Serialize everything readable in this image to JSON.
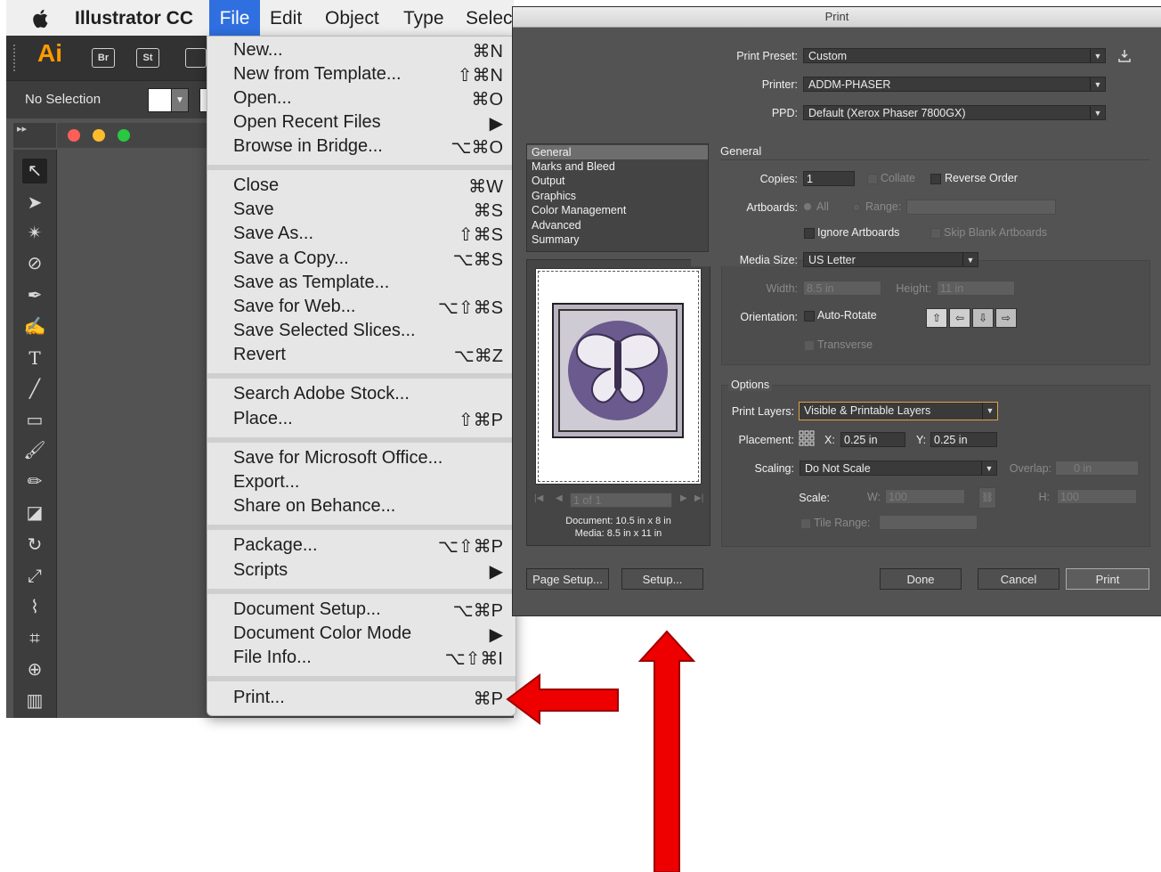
{
  "menubar": {
    "app_name": "Illustrator CC",
    "items": [
      "File",
      "Edit",
      "Object",
      "Type",
      "Selec"
    ]
  },
  "app": {
    "logo": "Ai",
    "pills": [
      "Br",
      "St"
    ],
    "control_text": "No Selection"
  },
  "file_menu": {
    "items": [
      {
        "label": "New...",
        "shortcut": "⌘N"
      },
      {
        "label": "New from Template...",
        "shortcut": "⇧⌘N"
      },
      {
        "label": "Open...",
        "shortcut": "⌘O"
      },
      {
        "label": "Open Recent Files",
        "shortcut": "▶"
      },
      {
        "label": "Browse in Bridge...",
        "shortcut": "⌥⌘O"
      },
      {
        "label": "Close",
        "shortcut": "⌘W"
      },
      {
        "label": "Save",
        "shortcut": "⌘S"
      },
      {
        "label": "Save As...",
        "shortcut": "⇧⌘S"
      },
      {
        "label": "Save a Copy...",
        "shortcut": "⌥⌘S"
      },
      {
        "label": "Save as Template...",
        "shortcut": ""
      },
      {
        "label": "Save for Web...",
        "shortcut": "⌥⇧⌘S"
      },
      {
        "label": "Save Selected Slices...",
        "shortcut": ""
      },
      {
        "label": "Revert",
        "shortcut": "⌥⌘Z"
      },
      {
        "label": "Search Adobe Stock...",
        "shortcut": ""
      },
      {
        "label": "Place...",
        "shortcut": "⇧⌘P"
      },
      {
        "label": "Save for Microsoft Office...",
        "shortcut": ""
      },
      {
        "label": "Export...",
        "shortcut": ""
      },
      {
        "label": "Share on Behance...",
        "shortcut": ""
      },
      {
        "label": "Package...",
        "shortcut": "⌥⇧⌘P"
      },
      {
        "label": "Scripts",
        "shortcut": "▶"
      },
      {
        "label": "Document Setup...",
        "shortcut": "⌥⌘P"
      },
      {
        "label": "Document Color Mode",
        "shortcut": "▶"
      },
      {
        "label": "File Info...",
        "shortcut": "⌥⇧⌘I"
      },
      {
        "label": "Print...",
        "shortcut": "⌘P"
      }
    ]
  },
  "print_dialog": {
    "title": "Print",
    "preset_label": "Print Preset:",
    "preset_value": "Custom",
    "printer_label": "Printer:",
    "printer_value": "ADDM-PHASER",
    "ppd_label": "PPD:",
    "ppd_value": "Default (Xerox Phaser 7800GX)",
    "categories": [
      "General",
      "Marks and Bleed",
      "Output",
      "Graphics",
      "Color Management",
      "Advanced",
      "Summary"
    ],
    "general": {
      "heading": "General",
      "copies_label": "Copies:",
      "copies_value": "1",
      "collate": "Collate",
      "reverse_order": "Reverse Order",
      "artboards_label": "Artboards:",
      "all": "All",
      "range": "Range:",
      "ignore_artboards": "Ignore Artboards",
      "skip_blank": "Skip Blank Artboards",
      "media_size_label": "Media Size:",
      "media_size_value": "US Letter",
      "width_label": "Width:",
      "width_value": "8.5 in",
      "height_label": "Height:",
      "height_value": "11 in",
      "orientation_label": "Orientation:",
      "auto_rotate": "Auto-Rotate",
      "transverse": "Transverse"
    },
    "options": {
      "heading": "Options",
      "print_layers_label": "Print Layers:",
      "print_layers_value": "Visible & Printable Layers",
      "placement_label": "Placement:",
      "x_label": "X:",
      "x_value": "0.25 in",
      "y_label": "Y:",
      "y_value": "0.25 in",
      "scaling_label": "Scaling:",
      "scaling_value": "Do Not Scale",
      "overlap_label": "Overlap:",
      "overlap_value": "0 in",
      "scale_label": "Scale:",
      "w_label": "W:",
      "w_value": "100",
      "h_label": "H:",
      "h_value": "100",
      "tile_range": "Tile Range:"
    },
    "preview": {
      "page_field": "1 of 1",
      "document_info": "Document: 10.5 in x 8 in",
      "media_info": "Media: 8.5 in x 11 in"
    },
    "buttons": {
      "page_setup": "Page Setup...",
      "setup": "Setup...",
      "done": "Done",
      "cancel": "Cancel",
      "print": "Print"
    }
  },
  "colors": {
    "menu_highlight": "#2f6fe0",
    "arrow_red": "#ee0000",
    "ai_orange": "#ff9a00"
  }
}
